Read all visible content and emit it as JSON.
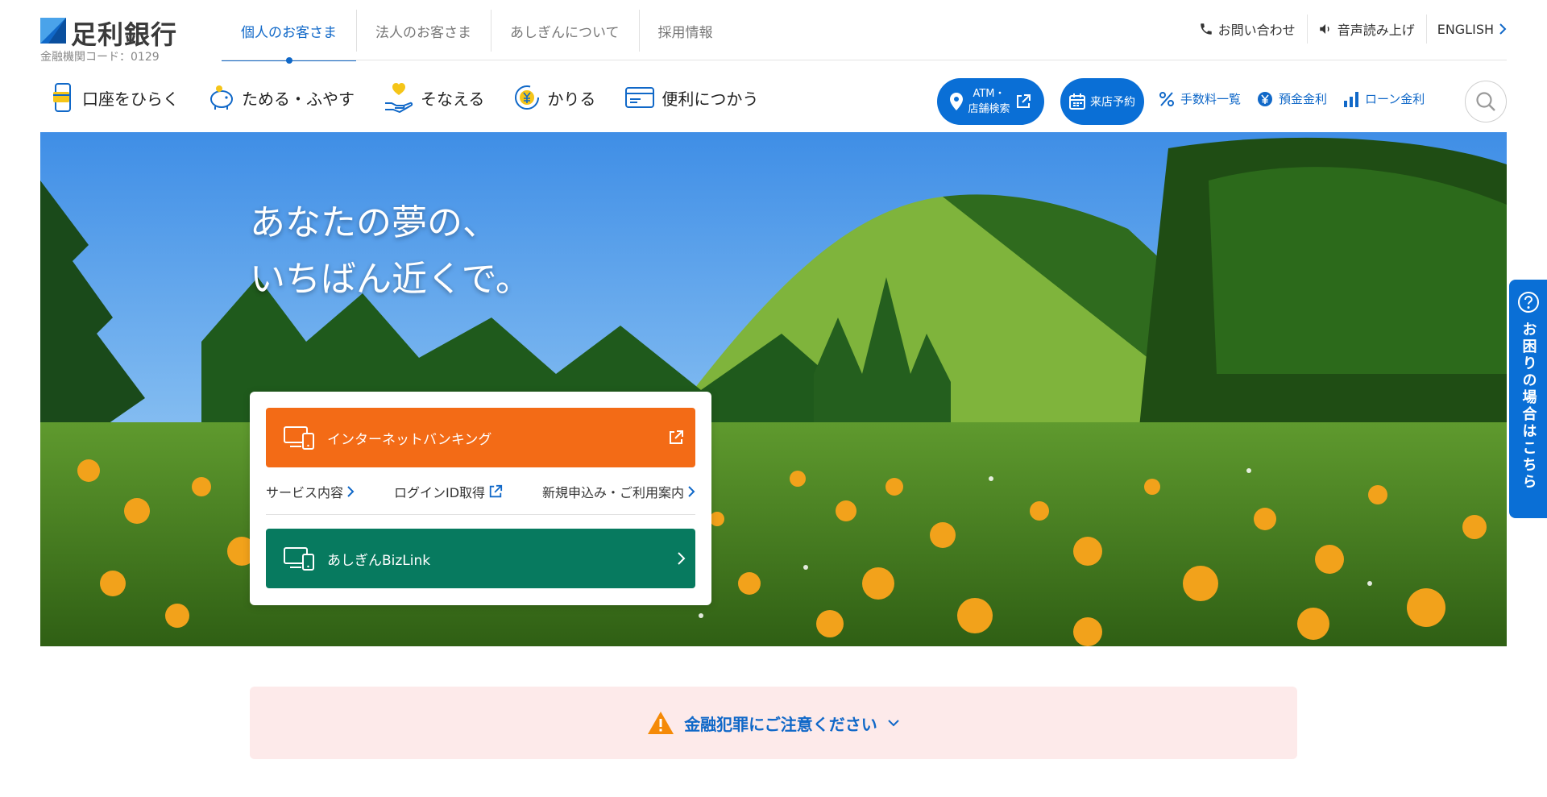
{
  "logo": {
    "name": "足利銀行",
    "bank_code": "金融機関コード：0129"
  },
  "top_tabs": [
    {
      "label": "個人のお客さま",
      "active": true
    },
    {
      "label": "法人のお客さま",
      "active": false
    },
    {
      "label": "あしぎんについて",
      "active": false
    },
    {
      "label": "採用情報",
      "active": false
    }
  ],
  "util_nav": {
    "contact": "お問い合わせ",
    "read_aloud": "音声読み上げ",
    "english": "ENGLISH"
  },
  "main_nav": [
    {
      "label": "口座をひらく",
      "icon": "smartphone-card-icon"
    },
    {
      "label": "ためる・ふやす",
      "icon": "piggy-bank-icon"
    },
    {
      "label": "そなえる",
      "icon": "heart-hand-icon"
    },
    {
      "label": "かりる",
      "icon": "yen-cycle-icon"
    },
    {
      "label": "便利につかう",
      "icon": "card-icon"
    }
  ],
  "pills": {
    "atm_line1": "ATM・",
    "atm_line2": "店舗検索",
    "visit": "来店予約"
  },
  "quick_links": [
    {
      "label": "手数料一覧",
      "icon": "percent-icon"
    },
    {
      "label": "預金金利",
      "icon": "yen-icon"
    },
    {
      "label": "ローン金利",
      "icon": "bar-chart-icon"
    }
  ],
  "hero": {
    "line1": "あなたの夢の、",
    "line2": "いちばん近くで。"
  },
  "login_card": {
    "internet_banking": "インターネットバンキング",
    "links": {
      "service": "サービス内容",
      "login_id": "ログインID取得",
      "apply": "新規申込み・ご利用案内"
    },
    "bizlink": "あしぎんBizLink"
  },
  "side_help": "お困りの場合はこちら",
  "alert": "金融犯罪にご注意ください",
  "colors": {
    "brand_blue": "#0a6fd6",
    "orange": "#f36b16",
    "green": "#077a5f",
    "alert_bg": "#fdeaea"
  }
}
